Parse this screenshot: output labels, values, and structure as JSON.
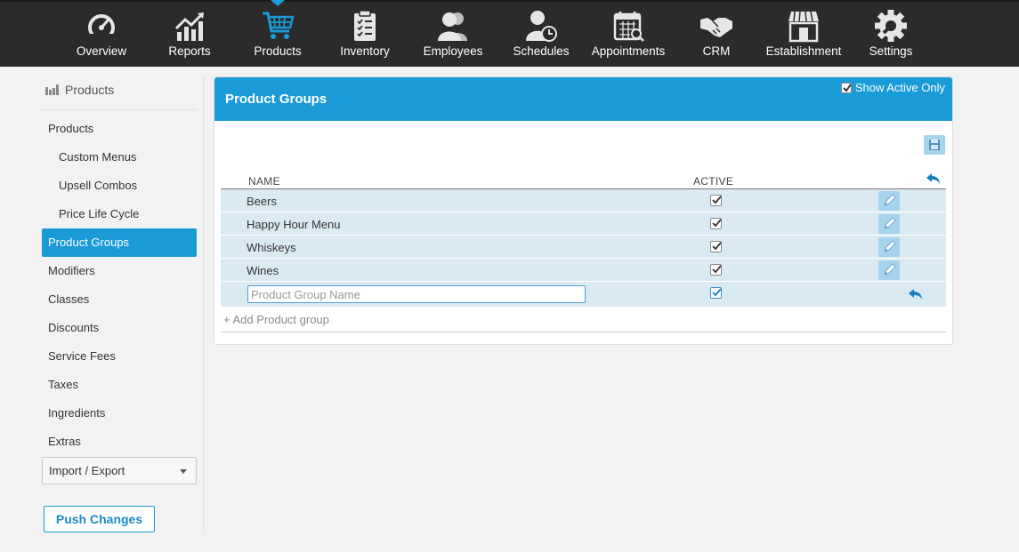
{
  "nav": {
    "items": [
      {
        "label": "Overview",
        "icon": "speedometer-icon"
      },
      {
        "label": "Reports",
        "icon": "chart-icon"
      },
      {
        "label": "Products",
        "icon": "cart-icon",
        "active": true
      },
      {
        "label": "Inventory",
        "icon": "clipboard-icon"
      },
      {
        "label": "Employees",
        "icon": "people-icon"
      },
      {
        "label": "Schedules",
        "icon": "person-clock-icon"
      },
      {
        "label": "Appointments",
        "icon": "calendar-icon"
      },
      {
        "label": "CRM",
        "icon": "handshake-icon"
      },
      {
        "label": "Establishment",
        "icon": "storefront-icon"
      },
      {
        "label": "Settings",
        "icon": "gear-icon"
      }
    ]
  },
  "sidebar": {
    "header": "Products",
    "items": [
      {
        "label": "Products",
        "sub": false
      },
      {
        "label": "Custom Menus",
        "sub": true
      },
      {
        "label": "Upsell Combos",
        "sub": true
      },
      {
        "label": "Price Life Cycle",
        "sub": true
      },
      {
        "label": "Product Groups",
        "sub": false,
        "active": true
      },
      {
        "label": "Modifiers",
        "sub": false
      },
      {
        "label": "Classes",
        "sub": false
      },
      {
        "label": "Discounts",
        "sub": false
      },
      {
        "label": "Service Fees",
        "sub": false
      },
      {
        "label": "Taxes",
        "sub": false
      },
      {
        "label": "Ingredients",
        "sub": false
      },
      {
        "label": "Extras",
        "sub": false
      }
    ],
    "select_value": "Import / Export",
    "push_label": "Push Changes"
  },
  "panel": {
    "title": "Product Groups",
    "show_active_label": "Show Active Only",
    "show_active_checked": true,
    "columns": {
      "name": "NAME",
      "active": "ACTIVE"
    },
    "rows": [
      {
        "name": "Beers",
        "active": true
      },
      {
        "name": "Happy Hour Menu",
        "active": true
      },
      {
        "name": "Whiskeys",
        "active": true
      },
      {
        "name": "Wines",
        "active": true
      }
    ],
    "new_row": {
      "placeholder": "Product Group Name",
      "value": "",
      "active": true
    },
    "add_label": "+ Add Product group"
  },
  "colors": {
    "accent": "#1a9ad6",
    "nav_bg": "#2b2b2b",
    "row_bg": "#d9eaf3",
    "icon_btn_bg": "#a8d3ec"
  }
}
